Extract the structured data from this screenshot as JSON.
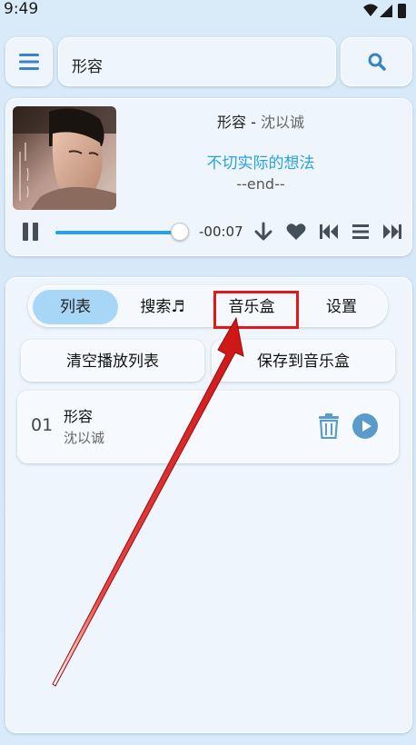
{
  "status_bar": {
    "time": "9:49"
  },
  "search": {
    "value": "形容",
    "placeholder": ""
  },
  "now_playing": {
    "title": "形容",
    "separator": " - ",
    "artist": "沈以诚",
    "lyric_current": "不切实际的想法",
    "lyric_next": "--end--",
    "time_remaining": "-00:07",
    "progress": 0.95
  },
  "tabs": [
    {
      "label": "列表",
      "active": true
    },
    {
      "label": "搜索♬",
      "active": false
    },
    {
      "label": "音乐盒",
      "active": false
    },
    {
      "label": "设置",
      "active": false
    }
  ],
  "actions": {
    "clear_label": "清空播放列表",
    "save_label": "保存到音乐盒"
  },
  "queue": [
    {
      "index": "01",
      "title": "形容",
      "artist": "沈以诚"
    }
  ],
  "colors": {
    "accent": "#2aa2e0",
    "icon": "#3a83c4",
    "highlight": "#e0191c"
  }
}
